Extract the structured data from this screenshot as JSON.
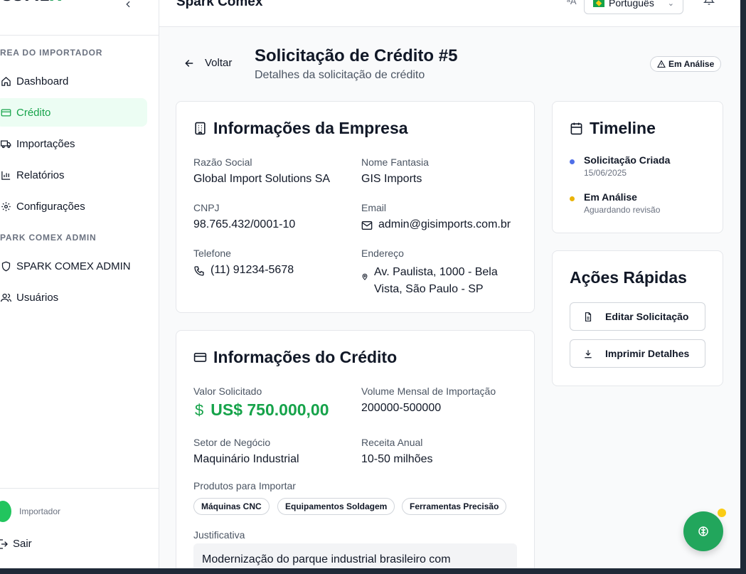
{
  "app": {
    "title": "Spark Comex",
    "logo_text": "COMEX",
    "logo_accent": "#22a05b"
  },
  "topbar": {
    "language": "Português"
  },
  "sidebar": {
    "section_importer": "REA DO IMPORTADOR",
    "items_importer": [
      {
        "label": "Dashboard",
        "icon": "home-icon"
      },
      {
        "label": "Crédito",
        "icon": "credit-card-icon",
        "active": true
      },
      {
        "label": "Importações",
        "icon": "truck-icon"
      },
      {
        "label": "Relatórios",
        "icon": "bar-chart-icon"
      },
      {
        "label": "Configurações",
        "icon": "gear-icon"
      }
    ],
    "section_admin": "PARK COMEX ADMIN",
    "items_admin": [
      {
        "label": "SPARK COMEX ADMIN",
        "icon": "shield-icon"
      },
      {
        "label": "Usuários",
        "icon": "users-icon"
      }
    ],
    "user_role": "Importador",
    "logout_label": "Sair"
  },
  "header": {
    "back_label": "Voltar",
    "title": "Solicitação de Crédito #5",
    "subtitle": "Detalhes da solicitação de crédito",
    "status": "Em Análise"
  },
  "company": {
    "title": "Informações da Empresa",
    "razao_label": "Razão Social",
    "razao_value": "Global Import Solutions SA",
    "fantasia_label": "Nome Fantasia",
    "fantasia_value": "GIS Imports",
    "cnpj_label": "CNPJ",
    "cnpj_value": "98.765.432/0001-10",
    "email_label": "Email",
    "email_value": "admin@gisimports.com.br",
    "phone_label": "Telefone",
    "phone_value": "(11) 91234-5678",
    "address_label": "Endereço",
    "address_line1": "Av. Paulista, 1000 - Bela",
    "address_line2": "Vista, São Paulo - SP"
  },
  "credit": {
    "title": "Informações do Crédito",
    "valor_label": "Valor Solicitado",
    "valor_symbol": "$",
    "valor_value": "US$ 750.000,00",
    "volume_label": "Volume Mensal de Importação",
    "volume_value": "200000-500000",
    "setor_label": "Setor de Negócio",
    "setor_value": "Maquinário Industrial",
    "receita_label": "Receita Anual",
    "receita_value": "10-50 milhões",
    "produtos_label": "Produtos para Importar",
    "produtos": [
      "Máquinas CNC",
      "Equipamentos Soldagem",
      "Ferramentas Precisão"
    ],
    "justificativa_label": "Justificativa",
    "justificativa_value": "Modernização do parque industrial brasileiro com"
  },
  "timeline": {
    "title": "Timeline",
    "events": [
      {
        "title": "Solicitação Criada",
        "sub": "15/06/2025",
        "color": "#4f6fe8"
      },
      {
        "title": "Em Análise",
        "sub": "Aguardando revisão",
        "color": "#eab308"
      }
    ]
  },
  "quick_actions": {
    "title": "Ações Rápidas",
    "edit_label": "Editar Solicitação",
    "print_label": "Imprimir Detalhes"
  }
}
